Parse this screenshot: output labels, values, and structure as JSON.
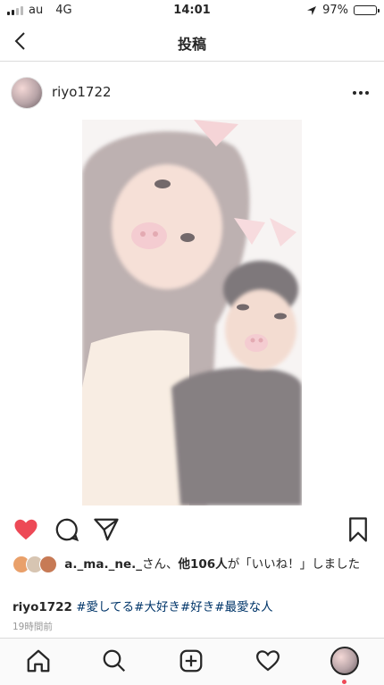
{
  "status_bar": {
    "carrier": "au",
    "network": "4G",
    "time": "14:01",
    "battery": "97%",
    "battery_level": 0.97
  },
  "nav": {
    "title": "投稿"
  },
  "post": {
    "username": "riyo1722",
    "liked": true,
    "likes": {
      "first_liker": "a._ma._ne._",
      "middle_text": "さん、",
      "others": "他106人",
      "suffix": "が「いいね！」しました"
    },
    "caption": {
      "username": "riyo1722",
      "hashtags": [
        "#愛してる",
        "#大好き",
        "#好き",
        "#最愛な人"
      ]
    },
    "timestamp": "19時間前"
  },
  "colors": {
    "like_red": "#ed4956",
    "hashtag_blue": "#003569",
    "text": "#262626",
    "muted": "#999999"
  },
  "icons": {
    "back": "chevron-left-icon",
    "more": "more-horizontal-icon",
    "like": "heart-filled-icon",
    "comment": "comment-icon",
    "share": "send-icon",
    "save": "bookmark-icon",
    "home": "home-icon",
    "search": "search-icon",
    "add": "add-post-icon",
    "activity": "heart-outline-icon",
    "profile": "profile-avatar-icon"
  }
}
